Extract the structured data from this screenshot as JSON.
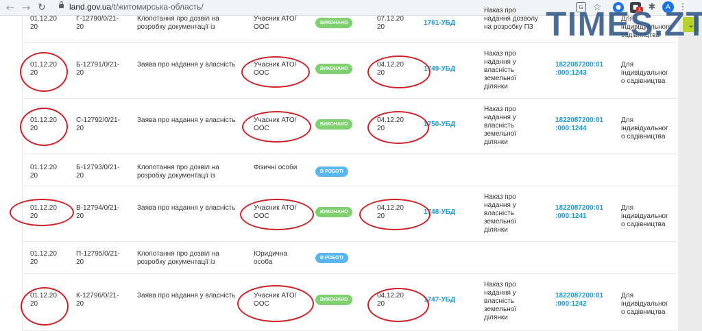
{
  "browser": {
    "url_host": "land.gov.ua",
    "url_path": "/t/житомирська-область/",
    "profile_initial": "A",
    "extension_badge": "1"
  },
  "watermark": "TIMES.ZT",
  "rows": [
    {
      "date": "01.12.20\n20",
      "num": "Г-12790/0/21-\n20",
      "type": "Клопотання про дозвіл на\nрозробку документації із",
      "category": "Учасник АТО/\nООС",
      "status": "ВИКОНАНО",
      "status_kind": "done",
      "reg_date": "07.12.20\n20",
      "doc": "1761-УБД",
      "decision": "Наказ про\nнадання дозволу\nна розробку ПЗ",
      "cadastre": "",
      "purpose": "Для\nіндивідуального\nсадівництва"
    },
    {
      "date": "01.12.20\n20",
      "num": "Б-12791/0/21-\n20",
      "type": "Заява про надання у власність",
      "category": "Учасник АТО/\nООС",
      "status": "ВИКОНАНО",
      "status_kind": "done",
      "reg_date": "04.12.20\n20",
      "doc": "1749-УБД",
      "decision": "Наказ про\nнадання у\nвласність\nземельної\nділянки",
      "cadastre": "1822087200:01\n:000:1243",
      "purpose": "Для\nіндивідуальног\nо садівництва"
    },
    {
      "date": "01.12.20\n20",
      "num": "С-12792/0/21-\n20",
      "type": "Заява про надання у власність",
      "category": "Учасник АТО/\nООС",
      "status": "ВИКОНАНО",
      "status_kind": "done",
      "reg_date": "04.12.20\n20",
      "doc": "1750-УБД",
      "decision": "Наказ про\nнадання у\nвласність\nземельної\nділянки",
      "cadastre": "1822087200:01\n:000:1244",
      "purpose": "Для\nіндивідуальног\nо садівництва"
    },
    {
      "date": "01.12.20\n20",
      "num": "Б-12793/0/21-\n20",
      "type": "Клопотання про дозвіл на\nрозробку документації із",
      "category": "Фізичні особи",
      "status": "В РОБОТІ",
      "status_kind": "work",
      "reg_date": "",
      "doc": "",
      "decision": "",
      "cadastre": "",
      "purpose": ""
    },
    {
      "date": "01.12.20\n20",
      "num": "В-12794/0/21-\n20",
      "type": "Заява про надання у власність",
      "category": "Учасник АТО/\nООС",
      "status": "ВИКОНАНО",
      "status_kind": "done",
      "reg_date": "04.12.20\n20",
      "doc": "1748-УБД",
      "decision": "Наказ про\nнадання у\nвласність\nземельної\nділянки",
      "cadastre": "1822087200:01\n:000:1241",
      "purpose": "Для\nіндивідуальног\nо садівництва"
    },
    {
      "date": "01.12.20\n20",
      "num": "П-12795/0/21-\n20",
      "type": "Клопотання про дозвіл на\nрозробку документації із",
      "category": "Юридична\nособа",
      "status": "В РОБОТІ",
      "status_kind": "work",
      "reg_date": "",
      "doc": "",
      "decision": "",
      "cadastre": "",
      "purpose": ""
    },
    {
      "date": "01.12.20\n20",
      "num": "К-12796/0/21-\n20",
      "type": "Заява про надання у власність",
      "category": "Учасник АТО/\nООС",
      "status": "ВИКОНАНО",
      "status_kind": "done",
      "reg_date": "04.12.20\n20",
      "doc": "1747-УБД",
      "decision": "Наказ про\nнадання у\nвласність\nземельної\nділянки",
      "cadastre": "1822087200:01\n:000:1242",
      "purpose": "Для\nіндивідуальног\nо садівництва"
    }
  ],
  "colors": {
    "done": "#7ed16e",
    "work": "#5bb5ee",
    "link": "#1a9bd7",
    "annotation": "#d11f26",
    "accent_button": "#b7d22b"
  }
}
